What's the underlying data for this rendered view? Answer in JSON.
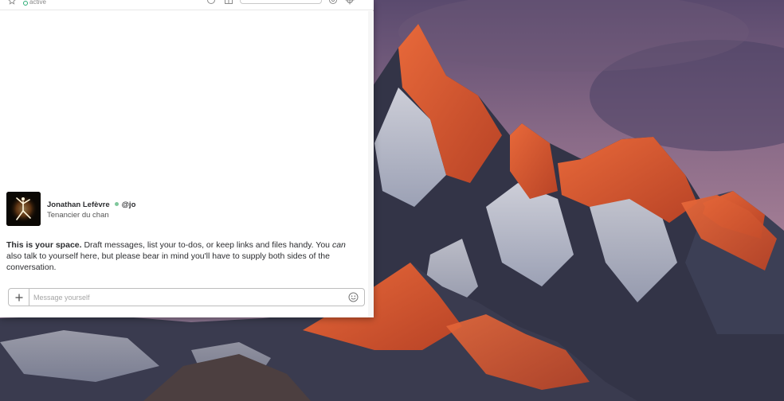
{
  "window": {
    "header": {
      "status": "active",
      "search_placeholder": ""
    },
    "profile": {
      "name": "Jonathan Lefèvre",
      "handle": "@jo",
      "title": "Tenancier du chan",
      "presence": "online"
    },
    "intro": {
      "bold": "This is your space.",
      "text_part1": " Draft messages, list your to-dos, or keep links and files handy. You ",
      "emphasis": "can",
      "text_part2": " also talk to yourself here, but please bear in mind you'll have to supply both sides of the conversation."
    },
    "composer": {
      "placeholder": "Message yourself",
      "value": ""
    }
  },
  "colors": {
    "presence": "#2bac76",
    "presence_dot": "#7fc79b",
    "text": "#2c2d30",
    "muted": "#a5a5a5"
  },
  "icons": {
    "header_left": "star-icon",
    "header_right": [
      "info-icon",
      "sidebar-icon",
      "mention-icon",
      "settings-icon"
    ],
    "composer_left": "plus-icon",
    "composer_right": "emoji-icon"
  }
}
